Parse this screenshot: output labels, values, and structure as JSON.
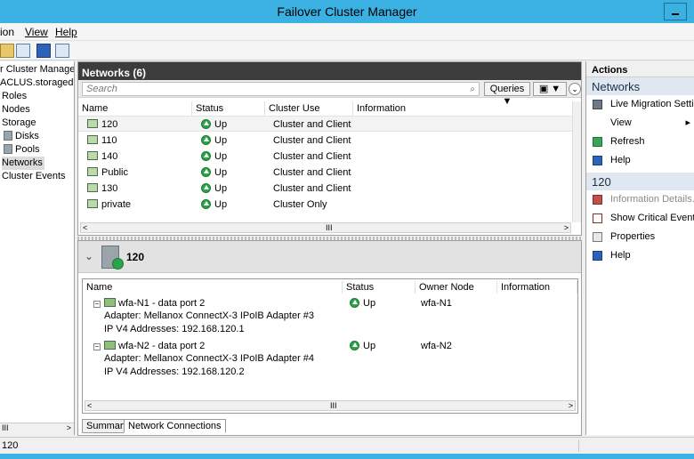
{
  "window": {
    "title": "Failover Cluster Manager"
  },
  "menu": {
    "action_label": "ion",
    "view_label": "View",
    "help_label": "Help"
  },
  "tree": {
    "items": [
      {
        "label": "r Cluster Manager",
        "indent": 0
      },
      {
        "label": "ACLUS.storagedon",
        "indent": 0
      },
      {
        "label": "Roles",
        "indent": 1
      },
      {
        "label": "Nodes",
        "indent": 1
      },
      {
        "label": "Storage",
        "indent": 1
      },
      {
        "label": "Disks",
        "indent": 2
      },
      {
        "label": "Pools",
        "indent": 2
      },
      {
        "label": "Networks",
        "indent": 1
      },
      {
        "label": "Cluster Events",
        "indent": 1
      }
    ],
    "scroll_grip": "III"
  },
  "networks": {
    "title": "Networks (6)",
    "search_placeholder": "Search",
    "queries_label": "Queries",
    "columns": [
      "Name",
      "Status",
      "Cluster Use",
      "Information"
    ],
    "rows": [
      {
        "name": "120",
        "status": "Up",
        "use": "Cluster and Client"
      },
      {
        "name": "110",
        "status": "Up",
        "use": "Cluster and Client"
      },
      {
        "name": "140",
        "status": "Up",
        "use": "Cluster and Client"
      },
      {
        "name": "Public",
        "status": "Up",
        "use": "Cluster and Client"
      },
      {
        "name": "130",
        "status": "Up",
        "use": "Cluster and Client"
      },
      {
        "name": "private",
        "status": "Up",
        "use": "Cluster Only"
      }
    ],
    "scroll_grip": "III"
  },
  "details": {
    "title": "120",
    "columns": [
      "Name",
      "Status",
      "Owner Node",
      "Information"
    ],
    "connections": [
      {
        "name": "wfa-N1 - data port 2",
        "adapter": "Adapter: Mellanox ConnectX-3 IPoIB Adapter #3",
        "ip": "IP V4 Addresses: 192.168.120.1",
        "status": "Up",
        "owner": "wfa-N1"
      },
      {
        "name": "wfa-N2 - data port 2",
        "adapter": "Adapter: Mellanox ConnectX-3 IPoIB Adapter #4",
        "ip": "IP V4 Addresses: 192.168.120.2",
        "status": "Up",
        "owner": "wfa-N2"
      }
    ],
    "scroll_grip": "III",
    "tabs": [
      "Summary",
      "Network Connections"
    ]
  },
  "actions": {
    "header": "Actions",
    "section1": "Networks",
    "section1_items": [
      "Live Migration Settings...",
      "View",
      "Refresh",
      "Help"
    ],
    "section2": "120",
    "section2_items": [
      "Information Details...",
      "Show Critical Events",
      "Properties",
      "Help"
    ]
  },
  "status": {
    "text": "120"
  }
}
